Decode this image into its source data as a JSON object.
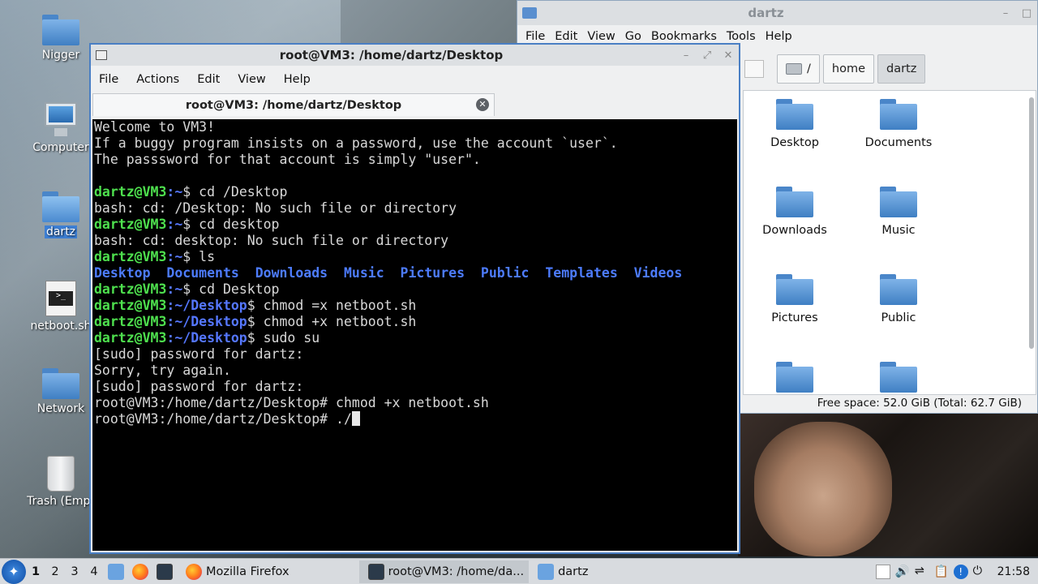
{
  "desktop": {
    "icons": [
      {
        "label": "Nigger",
        "icon": "folder-icon"
      },
      {
        "label": "Computer",
        "icon": "computer-icon"
      },
      {
        "label": "dartz",
        "icon": "home-folder-icon"
      },
      {
        "label": "netboot.sh",
        "icon": "script-icon"
      },
      {
        "label": "Network",
        "icon": "network-folder-icon"
      },
      {
        "label": "Trash (Empt",
        "icon": "trash-icon"
      }
    ]
  },
  "file_manager": {
    "title": "dartz",
    "menu": [
      "File",
      "Edit",
      "View",
      "Go",
      "Bookmarks",
      "Tools",
      "Help"
    ],
    "path": [
      "/",
      "home",
      "dartz"
    ],
    "items": [
      {
        "label": "Desktop",
        "icon": "desktop-folder-icon"
      },
      {
        "label": "Documents",
        "icon": "documents-folder-icon"
      },
      {
        "label": "Downloads",
        "icon": "downloads-folder-icon"
      },
      {
        "label": "Music",
        "icon": "music-folder-icon"
      },
      {
        "label": "Pictures",
        "icon": "pictures-folder-icon"
      },
      {
        "label": "Public",
        "icon": "public-folder-icon"
      },
      {
        "label": "",
        "icon": "templates-folder-icon"
      },
      {
        "label": "",
        "icon": "videos-folder-icon"
      }
    ],
    "status": "Free space: 52.0 GiB (Total: 62.7 GiB)"
  },
  "terminal": {
    "title": "root@VM3: /home/dartz/Desktop",
    "menu": [
      "File",
      "Actions",
      "Edit",
      "View",
      "Help"
    ],
    "tab_label": "root@VM3: /home/dartz/Desktop",
    "lines": [
      {
        "plain": "Welcome to VM3!"
      },
      {
        "plain": "If a buggy program insists on a password, use the account `user`."
      },
      {
        "plain": "The passsword for that account is simply \"user\"."
      },
      {
        "plain": ""
      },
      {
        "prompt": "dartz@VM3",
        "path": ":~",
        "cmd": "$ cd /Desktop"
      },
      {
        "plain": "bash: cd: /Desktop: No such file or directory"
      },
      {
        "prompt": "dartz@VM3",
        "path": ":~",
        "cmd": "$ cd desktop"
      },
      {
        "plain": "bash: cd: desktop: No such file or directory"
      },
      {
        "prompt": "dartz@VM3",
        "path": ":~",
        "cmd": "$ ls"
      },
      {
        "dirs": [
          "Desktop",
          "Documents",
          "Downloads",
          "Music",
          "Pictures",
          "Public",
          "Templates",
          "Videos"
        ]
      },
      {
        "prompt": "dartz@VM3",
        "path": ":~",
        "cmd": "$ cd Desktop"
      },
      {
        "prompt": "dartz@VM3",
        "path": ":~/Desktop",
        "cmd": "$ chmod =x netboot.sh"
      },
      {
        "prompt": "dartz@VM3",
        "path": ":~/Desktop",
        "cmd": "$ chmod +x netboot.sh"
      },
      {
        "prompt": "dartz@VM3",
        "path": ":~/Desktop",
        "cmd": "$ sudo su"
      },
      {
        "plain": "[sudo] password for dartz:"
      },
      {
        "plain": "Sorry, try again."
      },
      {
        "plain": "[sudo] password for dartz:"
      },
      {
        "plain": "root@VM3:/home/dartz/Desktop# chmod +x netboot.sh"
      },
      {
        "plain": "root@VM3:/home/dartz/Desktop# ./",
        "cursor": true
      }
    ]
  },
  "taskbar": {
    "workspaces": [
      "1",
      "2",
      "3",
      "4"
    ],
    "tasks": [
      {
        "label": "Mozilla Firefox",
        "icon": "firefox-icon"
      },
      {
        "label": "root@VM3: /home/da...",
        "icon": "terminal-icon"
      },
      {
        "label": "dartz",
        "icon": "folder-icon"
      }
    ],
    "clock": "21:58"
  }
}
